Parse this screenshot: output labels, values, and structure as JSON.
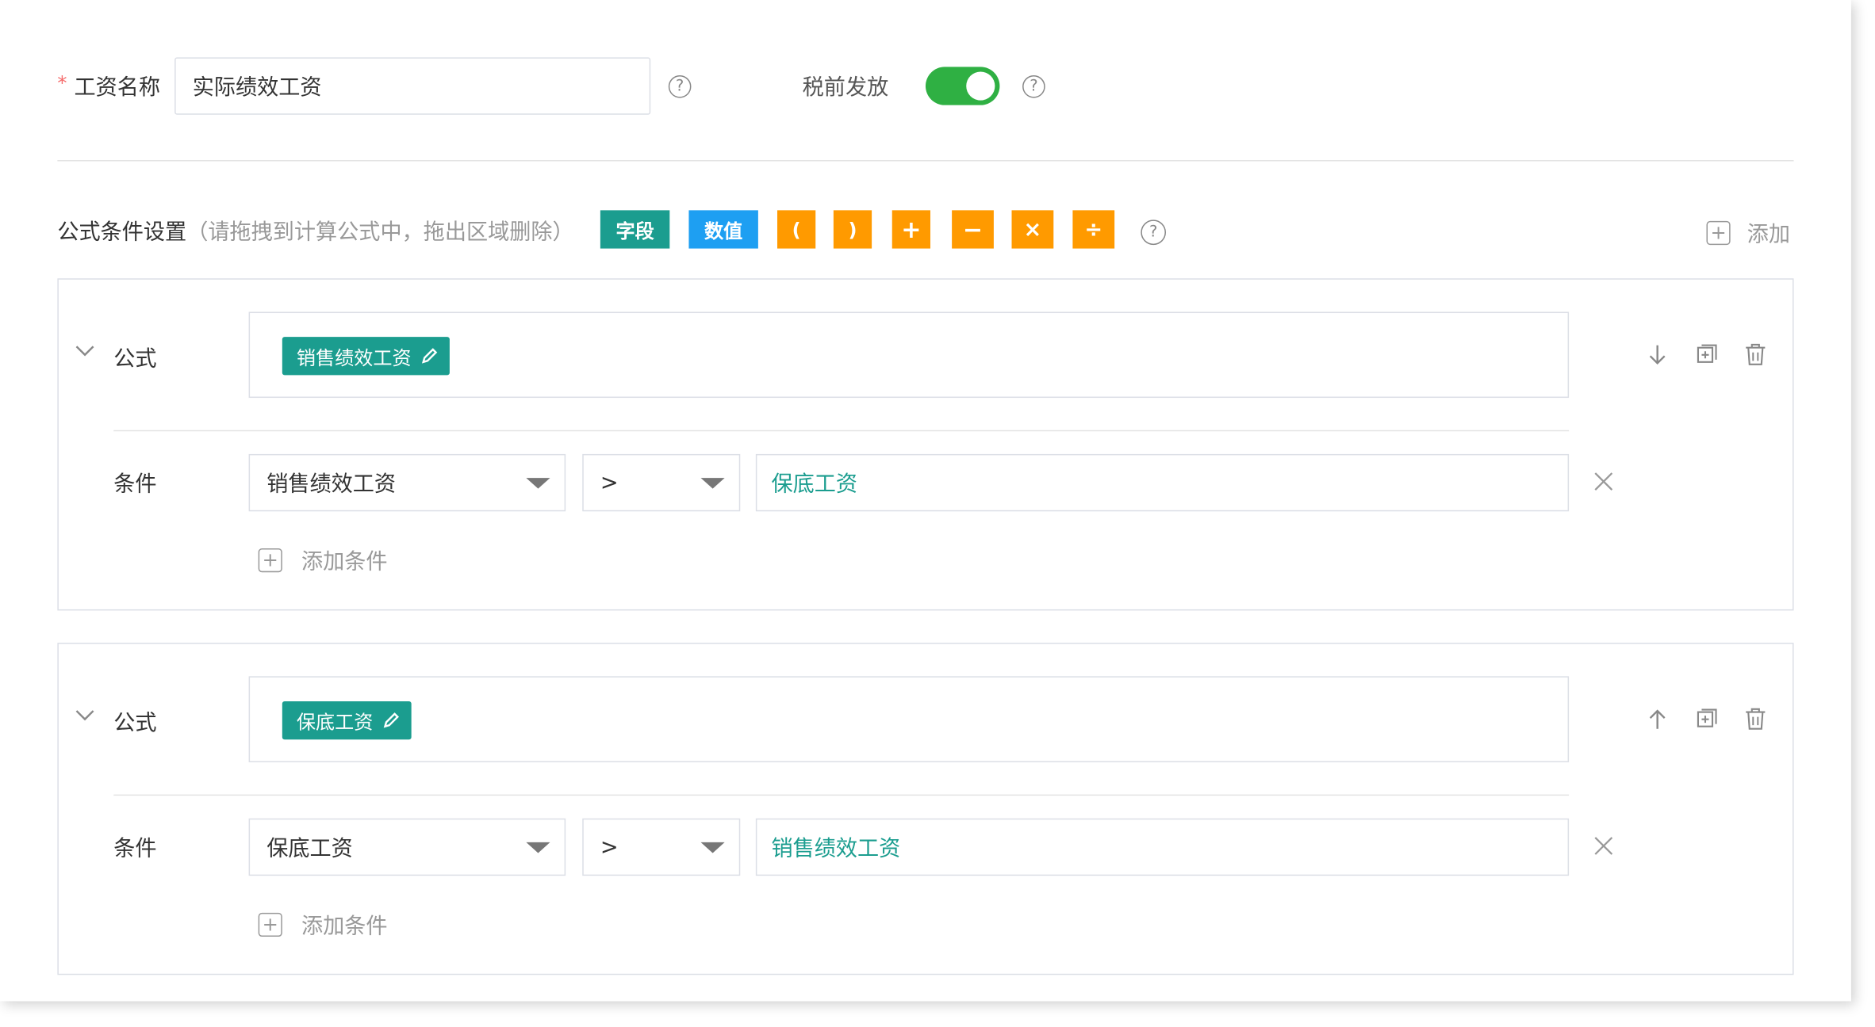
{
  "form": {
    "required_mark": "*",
    "name_label": "工资名称",
    "name_value": "实际绩效工资",
    "pretax_label": "税前发放",
    "pretax_on": true
  },
  "formula_settings": {
    "title": "公式条件设置",
    "hint": "（请拖拽到计算公式中，拖出区域删除）",
    "tags": {
      "field": "字段",
      "value": "数值",
      "lparen": "(",
      "rparen": ")",
      "plus": "+",
      "minus": "−",
      "times": "×",
      "divide": "÷"
    },
    "add_label": "添加"
  },
  "blocks": [
    {
      "formula_label": "公式",
      "chip": "销售绩效工资",
      "condition_label": "条件",
      "condition_field": "销售绩效工资",
      "operator": ">",
      "compare_value": "保底工资",
      "add_condition": "添加条件",
      "move_icon": "arrow-down-icon"
    },
    {
      "formula_label": "公式",
      "chip": "保底工资",
      "condition_label": "条件",
      "condition_field": "保底工资",
      "operator": ">",
      "compare_value": "销售绩效工资",
      "add_condition": "添加条件",
      "move_icon": "arrow-up-icon"
    }
  ],
  "colors": {
    "teal": "#1b9d8f",
    "blue": "#1e9ff2",
    "orange": "#ff9a00",
    "green_toggle": "#2fb043",
    "required": "#f56c6c"
  }
}
